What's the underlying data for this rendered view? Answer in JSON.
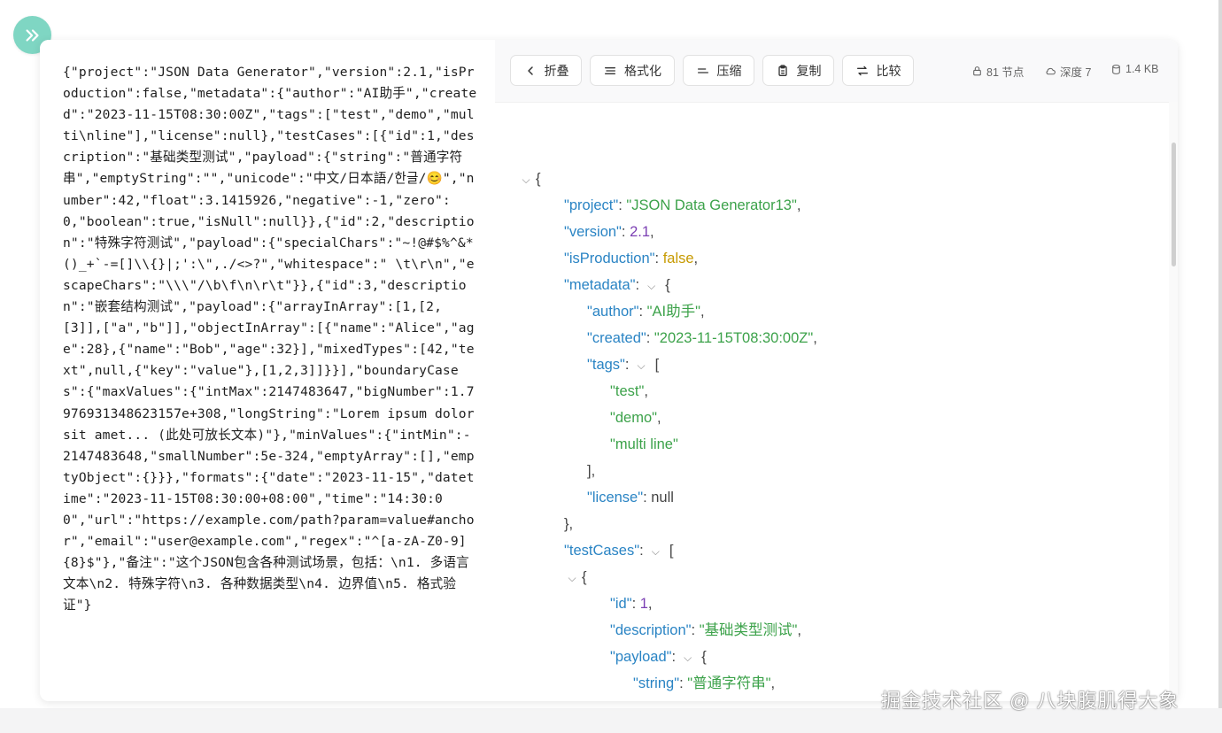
{
  "raw_json_text": "{\"project\":\"JSON Data Generator\",\"version\":2.1,\"isProduction\":false,\"metadata\":{\"author\":\"AI助手\",\"created\":\"2023-11-15T08:30:00Z\",\"tags\":[\"test\",\"demo\",\"multi\\nline\"],\"license\":null},\"testCases\":[{\"id\":1,\"description\":\"基础类型测试\",\"payload\":{\"string\":\"普通字符串\",\"emptyString\":\"\",\"unicode\":\"中文/日本語/한글/😊\",\"number\":42,\"float\":3.1415926,\"negative\":-1,\"zero\":0,\"boolean\":true,\"isNull\":null}},{\"id\":2,\"description\":\"特殊字符测试\",\"payload\":{\"specialChars\":\"~!@#$%^&*()_+`-=[]\\\\{}|;':\\\",./<>?\",\"whitespace\":\" \\t\\r\\n\",\"escapeChars\":\"\\\\\\\"/\\b\\f\\n\\r\\t\"}},{\"id\":3,\"description\":\"嵌套结构测试\",\"payload\":{\"arrayInArray\":[1,[2,[3]],[\"a\",\"b\"]],\"objectInArray\":[{\"name\":\"Alice\",\"age\":28},{\"name\":\"Bob\",\"age\":32}],\"mixedTypes\":[42,\"text\",null,{\"key\":\"value\"},[1,2,3]]}}],\"boundaryCases\":{\"maxValues\":{\"intMax\":2147483647,\"bigNumber\":1.7976931348623157e+308,\"longString\":\"Lorem ipsum dolor sit amet... (此处可放长文本)\"},\"minValues\":{\"intMin\":-2147483648,\"smallNumber\":5e-324,\"emptyArray\":[],\"emptyObject\":{}}},\"formats\":{\"date\":\"2023-11-15\",\"datetime\":\"2023-11-15T08:30:00+08:00\",\"time\":\"14:30:00\",\"url\":\"https://example.com/path?param=value#anchor\",\"email\":\"user@example.com\",\"regex\":\"^[a-zA-Z0-9]{8}$\"},\"备注\":\"这个JSON包含各种测试场景，包括：\\n1. 多语言文本\\n2. 特殊字符\\n3. 各种数据类型\\n4. 边界值\\n5. 格式验证\"}",
  "toolbar": {
    "collapse": "折叠",
    "format": "格式化",
    "compress": "压缩",
    "copy": "复制",
    "compare": "比较"
  },
  "stats": {
    "nodes": "81 节点",
    "depth": "深度 7",
    "size": "1.4 KB"
  },
  "tree": [
    {
      "indent": 0,
      "toggle": true,
      "open": "{"
    },
    {
      "indent": 1,
      "key": "\"project\"",
      "value": "\"JSON Data Generator13\"",
      "type": "s",
      "comma": ","
    },
    {
      "indent": 1,
      "key": "\"version\"",
      "value": "2.1",
      "type": "n",
      "comma": ","
    },
    {
      "indent": 1,
      "key": "\"isProduction\"",
      "value": "false",
      "type": "b",
      "comma": ","
    },
    {
      "indent": 1,
      "key": "\"metadata\"",
      "toggle": true,
      "open": "{"
    },
    {
      "indent": 2,
      "key": "\"author\"",
      "value": "\"AI助手\"",
      "type": "s",
      "comma": ","
    },
    {
      "indent": 2,
      "key": "\"created\"",
      "value": "\"2023-11-15T08:30:00Z\"",
      "type": "s",
      "comma": ","
    },
    {
      "indent": 2,
      "key": "\"tags\"",
      "toggle": true,
      "open": "["
    },
    {
      "indent": 3,
      "value": "\"test\"",
      "type": "s",
      "comma": ","
    },
    {
      "indent": 3,
      "value": "\"demo\"",
      "type": "s",
      "comma": ","
    },
    {
      "indent": 3,
      "value": "\"multi line\"",
      "type": "s",
      "comma": ""
    },
    {
      "indent": 2,
      "close": "],"
    },
    {
      "indent": 2,
      "key": "\"license\"",
      "value": "null",
      "type": "nl",
      "comma": ""
    },
    {
      "indent": 1,
      "close": "},"
    },
    {
      "indent": 1,
      "key": "\"testCases\"",
      "toggle": true,
      "open": "["
    },
    {
      "indent": 2,
      "toggle": true,
      "open": "{"
    },
    {
      "indent": 3,
      "key": "\"id\"",
      "value": "1",
      "type": "n",
      "comma": ","
    },
    {
      "indent": 3,
      "key": "\"description\"",
      "value": "\"基础类型测试\"",
      "type": "s",
      "comma": ","
    },
    {
      "indent": 3,
      "key": "\"payload\"",
      "toggle": true,
      "open": "{"
    },
    {
      "indent": 4,
      "key": "\"string\"",
      "value": "\"普通字符串\"",
      "type": "s",
      "comma": ","
    },
    {
      "indent": 4,
      "key": "\"emptyString\"",
      "value": "\"\"",
      "type": "s",
      "comma": ","
    },
    {
      "indent": 4,
      "key": "\"unicode\"",
      "value": "\"中文/日本語/한글/😊\"",
      "type": "s",
      "comma": ""
    }
  ],
  "watermark": "掘金技术社区 @ 八块腹肌得大象"
}
